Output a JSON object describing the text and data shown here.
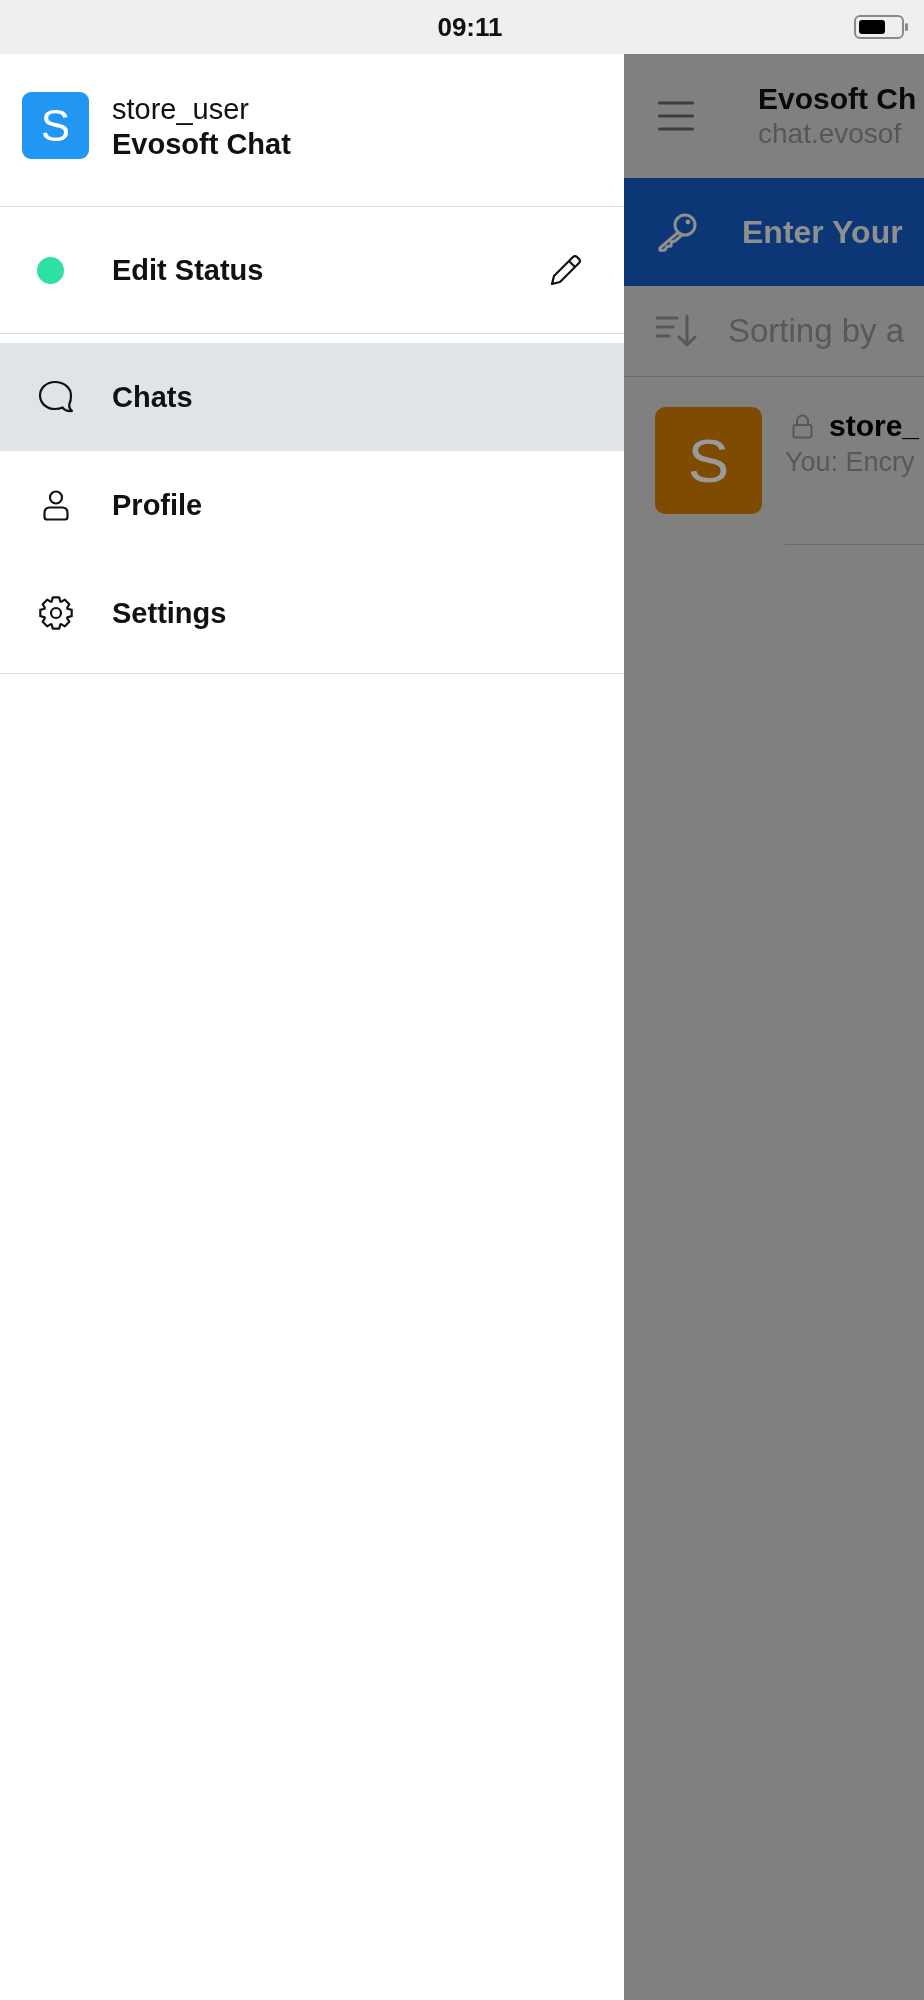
{
  "status_bar": {
    "time": "09:11"
  },
  "drawer": {
    "account": {
      "avatar_letter": "S",
      "username": "store_user",
      "server": "Evosoft Chat"
    },
    "status": {
      "label": "Edit Status",
      "online": true
    },
    "menu": [
      {
        "kind": "chats",
        "label": "Chats",
        "selected": true
      },
      {
        "kind": "profile",
        "label": "Profile",
        "selected": false
      },
      {
        "kind": "settings",
        "label": "Settings",
        "selected": false
      }
    ]
  },
  "chat_screen": {
    "title": "Evosoft Ch",
    "subtitle": "chat.evosof",
    "banner": "Enter Your",
    "sort_label": "Sorting by a",
    "chats": [
      {
        "avatar_letter": "S",
        "color": "#7f4b00",
        "encrypted": true,
        "name": "store_",
        "preview": "You: Encry"
      }
    ]
  }
}
